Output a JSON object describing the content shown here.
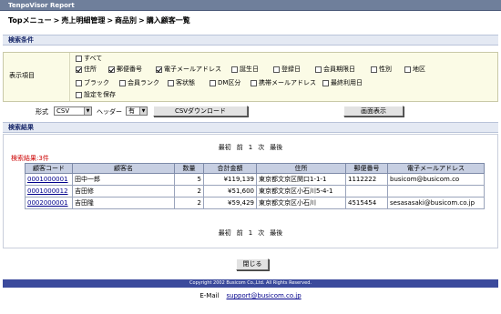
{
  "app": {
    "title": "TenpoVisor Report"
  },
  "breadcrumb": {
    "items": [
      "Topメニュー",
      "売上明細管理",
      "商品別",
      "購入顧客一覧"
    ],
    "separator": ">"
  },
  "search": {
    "header": "検索条件",
    "display_label": "表示項目",
    "options": [
      {
        "label": "すべて",
        "checked": false
      },
      {
        "label": "住所",
        "checked": true
      },
      {
        "label": "郵便番号",
        "checked": true
      },
      {
        "label": "電子メールアドレス",
        "checked": true
      },
      {
        "label": "誕生日",
        "checked": false
      },
      {
        "label": "登録日",
        "checked": false
      },
      {
        "label": "会員期限日",
        "checked": false
      },
      {
        "label": "性別",
        "checked": false
      },
      {
        "label": "地区",
        "checked": false
      },
      {
        "label": "ブラック",
        "checked": false
      },
      {
        "label": "会員ランク",
        "checked": false
      },
      {
        "label": "客状態",
        "checked": false
      },
      {
        "label": "DM区分",
        "checked": false
      },
      {
        "label": "携帯メールアドレス",
        "checked": false
      },
      {
        "label": "最終利用日",
        "checked": false
      },
      {
        "label": "設定を保存",
        "checked": false
      }
    ]
  },
  "format": {
    "format_label": "形式",
    "format_value": "CSV",
    "header_label": "ヘッダー",
    "header_value": "有",
    "csv_button": "CSVダウンロード",
    "screen_button": "画面表示"
  },
  "results": {
    "header": "検索結果",
    "count_text": "検索結果:3件",
    "pager": [
      "最初",
      "前",
      "1",
      "次",
      "最後"
    ],
    "columns": [
      "顧客コード",
      "顧客名",
      "数量",
      "合計金額",
      "住所",
      "郵便番号",
      "電子メールアドレス"
    ],
    "rows": [
      [
        "0001000001",
        "田中一郎",
        "5",
        "¥119,139",
        "東京都文京区関口1-1-1",
        "1112222",
        "busicom@busicom.co"
      ],
      [
        "0001000012",
        "吉田修",
        "2",
        "¥51,600",
        "東京都文京区小石川5-4-1",
        "",
        ""
      ],
      [
        "0002000001",
        "吉田隆",
        "2",
        "¥59,429",
        "東京都文京区小石川",
        "4515454",
        "sesasasaki@busicom.co.jp"
      ]
    ]
  },
  "close_button": "閉じる",
  "footer": {
    "copyright": "Copyright 2002 Busicom Co.,Ltd. All Rights Reserved.",
    "email_label": "E-Mail",
    "email_link": "support@busicom.co.jp"
  },
  "colors": {
    "topbar": "#6f7f9b",
    "section_bg": "#e4e9f3",
    "cond_bg": "#fbfbe6",
    "footer": "#3b4a9c",
    "count_red": "#cc0000"
  }
}
